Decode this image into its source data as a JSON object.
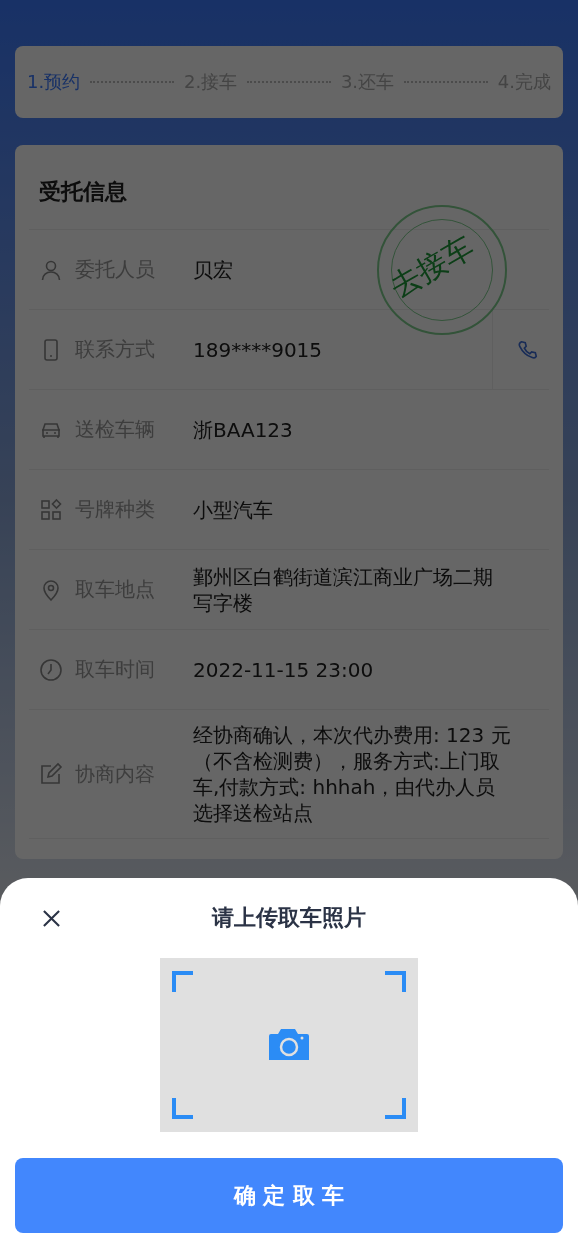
{
  "steps": [
    {
      "label": "1.预约",
      "selected": true
    },
    {
      "label": "2.接车",
      "selected": false
    },
    {
      "label": "3.还车",
      "selected": false
    },
    {
      "label": "4.完成",
      "selected": false
    }
  ],
  "info": {
    "title": "受托信息",
    "stamp": "去接车",
    "rows": [
      {
        "label": "委托人员",
        "value": "贝宏",
        "kind": "text"
      },
      {
        "label": "联系方式",
        "value": "189****9015",
        "kind": "phone"
      },
      {
        "label": "送检车辆",
        "value": "浙BAA123",
        "kind": "text"
      },
      {
        "label": "号牌种类",
        "value": "小型汽车",
        "kind": "text"
      },
      {
        "label": "取车地点",
        "value": "鄞州区白鹤街道滨江商业广场二期写字楼",
        "kind": "text"
      },
      {
        "label": "取车时间",
        "value": "2022-11-15 23:00",
        "kind": "text"
      },
      {
        "label": "协商内容",
        "value": "经协商确认，本次代办费用: 123 元（不含检测费），服务方式:上门取车,付款方式: hhhah，由代办人员选择送检站点",
        "kind": "text"
      }
    ]
  },
  "sheet": {
    "title": "请上传取车照片",
    "confirm": "确 定 取 车"
  }
}
